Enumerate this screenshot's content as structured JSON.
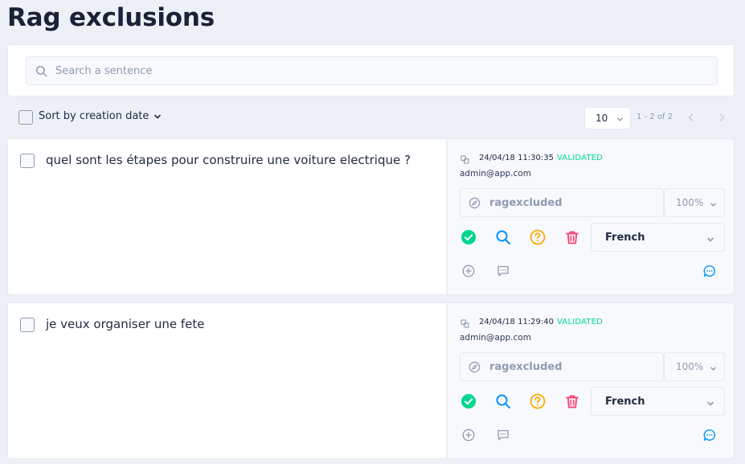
{
  "page": {
    "title": "Rag exclusions"
  },
  "search": {
    "placeholder": "Search a sentence",
    "icon": "search-icon"
  },
  "toolbar": {
    "sort_label": "Sort by creation date",
    "page_size": "10",
    "page_range": "1 - 2 of 2"
  },
  "colors": {
    "validated": "#00d68f",
    "search_action": "#0095ff",
    "unknown_action": "#ffaa00",
    "delete_action": "#ff3d71",
    "muted": "#8f9bb3"
  },
  "sentences": [
    {
      "text": "quel sont les étapes pour construire une voiture electrique ?",
      "date": "24/04/18 11:30:35",
      "status": "VALIDATED",
      "user": "admin@app.com",
      "intent": "ragexcluded",
      "score": "100%",
      "language": "French"
    },
    {
      "text": "je veux organiser une fete",
      "date": "24/04/18 11:29:40",
      "status": "VALIDATED",
      "user": "admin@app.com",
      "intent": "ragexcluded",
      "score": "100%",
      "language": "French"
    }
  ]
}
